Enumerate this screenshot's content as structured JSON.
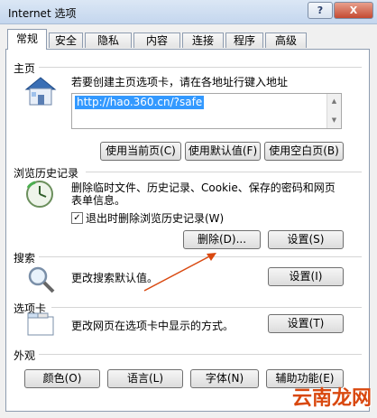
{
  "window": {
    "title": "Internet 选项",
    "help": "?",
    "close": "X"
  },
  "tabs": [
    "常规",
    "安全",
    "隐私",
    "内容",
    "连接",
    "程序",
    "高级"
  ],
  "home": {
    "title": "主页",
    "instruction": "若要创建主页选项卡，请在各地址行键入地址",
    "url": "http://hao.360.cn/?safe",
    "use_current": "使用当前页(C)",
    "use_default": "使用默认值(F)",
    "use_blank": "使用空白页(B)"
  },
  "history": {
    "title": "浏览历史记录",
    "desc_line1": "删除临时文件、历史记录、Cookie、保存的密码和网页",
    "desc_line2": "表单信息。",
    "checkbox_label": "退出时删除浏览历史记录(W)",
    "checked": true,
    "delete": "删除(D)...",
    "settings": "设置(S)"
  },
  "search": {
    "title": "搜索",
    "desc": "更改搜索默认值。",
    "settings": "设置(I)"
  },
  "tabs_section": {
    "title": "选项卡",
    "desc": "更改网页在选项卡中显示的方式。",
    "settings": "设置(T)"
  },
  "appearance": {
    "title": "外观",
    "colors": "颜色(O)",
    "languages": "语言(L)",
    "fonts": "字体(N)",
    "accessibility": "辅助功能(E)"
  },
  "watermark": "云南龙网",
  "colors": {
    "accent": "#3399ff",
    "arrow": "#d9480f"
  }
}
